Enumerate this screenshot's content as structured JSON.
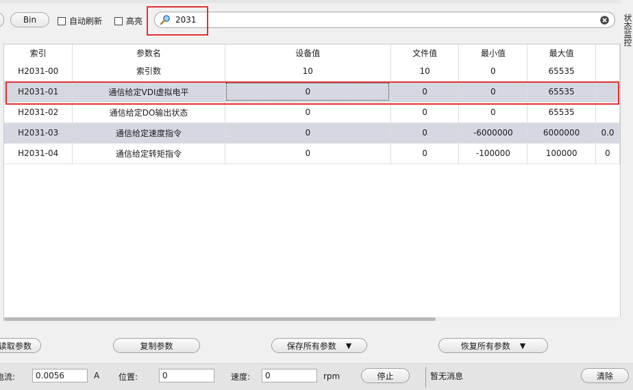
{
  "toolbar": {
    "bin_label": "Bin",
    "auto_refresh_label": "自动刷新",
    "highlight_label": "高亮",
    "search_value": "2031"
  },
  "side_tab": {
    "label": "状态监控"
  },
  "table": {
    "columns": [
      "索引",
      "参数名",
      "设备值",
      "文件值",
      "最小值",
      "最大值",
      ""
    ],
    "rows": [
      [
        "H2031-00",
        "索引数",
        "10",
        "10",
        "0",
        "65535",
        ""
      ],
      [
        "H2031-01",
        "通信给定VDI虚拟电平",
        "0",
        "0",
        "0",
        "65535",
        ""
      ],
      [
        "H2031-02",
        "通信给定DO输出状态",
        "0",
        "0",
        "0",
        "65535",
        ""
      ],
      [
        "H2031-03",
        "通信给定速度指令",
        "0",
        "0",
        "-6000000",
        "6000000",
        "0.0"
      ],
      [
        "H2031-04",
        "通信给定转矩指令",
        "0",
        "0",
        "-100000",
        "100000",
        "0"
      ]
    ]
  },
  "actions": {
    "read_params": "读取参数",
    "copy_params": "复制参数",
    "save_all": "保存所有参数",
    "restore_all": "恢复所有参数"
  },
  "status": {
    "current_label": "电流:",
    "current_value": "0.0056",
    "current_unit": "A",
    "position_label": "位置:",
    "position_value": "0",
    "speed_label": "速度:",
    "speed_value": "0",
    "speed_unit": "rpm",
    "stop_label": "停止",
    "message": "暂无消息",
    "clear_label": "清除"
  }
}
